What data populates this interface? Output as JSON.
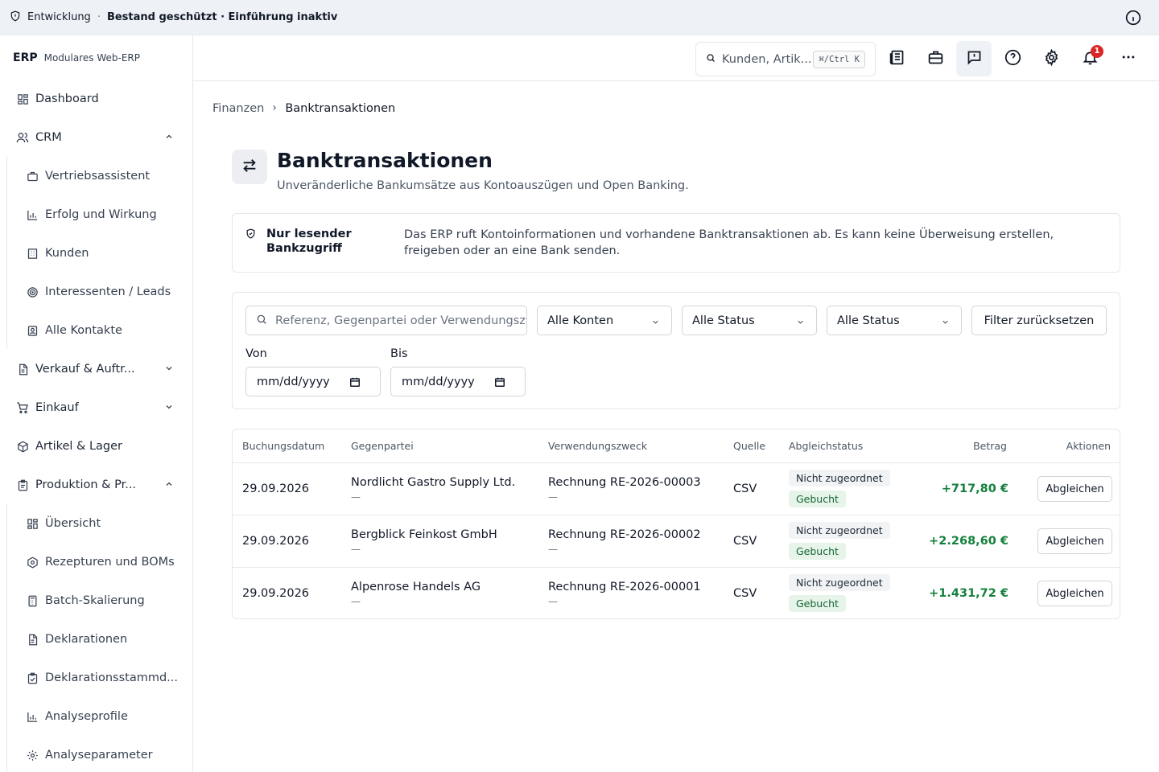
{
  "banner": {
    "env": "Entwicklung",
    "separator": "·",
    "status": "Bestand geschützt · Einführung inaktiv"
  },
  "brand": {
    "logo": "ERP",
    "subtitle": "Modulares Web-ERP"
  },
  "sidebar": {
    "items": [
      {
        "label": "Dashboard",
        "icon": "dashboard-icon"
      },
      {
        "label": "CRM",
        "icon": "users-icon",
        "expanded": true
      },
      {
        "label": "Vertriebsassistent",
        "icon": "briefcase-icon"
      },
      {
        "label": "Erfolg und Wirkung",
        "icon": "bar-chart-icon"
      },
      {
        "label": "Kunden",
        "icon": "building-icon"
      },
      {
        "label": "Interessenten / Leads",
        "icon": "target-icon"
      },
      {
        "label": "Alle Kontakte",
        "icon": "contact-icon"
      },
      {
        "label": "Verkauf & Auftr...",
        "icon": "document-icon",
        "expanded": false
      },
      {
        "label": "Einkauf",
        "icon": "cart-icon",
        "expanded": false
      },
      {
        "label": "Artikel & Lager",
        "icon": "package-icon"
      },
      {
        "label": "Produktion & Pr...",
        "icon": "clipboard-icon",
        "expanded": true
      },
      {
        "label": "Übersicht",
        "icon": "grid-icon"
      },
      {
        "label": "Rezepturen und BOMs",
        "icon": "recipe-icon"
      },
      {
        "label": "Batch-Skalierung",
        "icon": "calculator-icon"
      },
      {
        "label": "Deklarationen",
        "icon": "document-icon"
      },
      {
        "label": "Deklarationsstammd...",
        "icon": "clipboard-check-icon"
      },
      {
        "label": "Analyseprofile",
        "icon": "bar-chart-icon"
      },
      {
        "label": "Analyseparameter",
        "icon": "gear-icon"
      }
    ]
  },
  "header": {
    "search_placeholder": "Kunden, Artik...",
    "shortcut": "⌘/Ctrl K",
    "notification_count": "1"
  },
  "breadcrumb": {
    "parent": "Finanzen",
    "current": "Banktransaktionen"
  },
  "page": {
    "title": "Banktransaktionen",
    "subtitle": "Unveränderliche Bankumsätze aus Kontoauszügen und Open Banking."
  },
  "notice": {
    "title": "Nur lesender Bankzugriff",
    "text": "Das ERP ruft Kontoinformationen und vorhandene Banktransaktionen ab. Es kann keine Überweisung erstellen, freigeben oder an eine Bank senden."
  },
  "filters": {
    "search_placeholder": "Referenz, Gegenpartei oder Verwendungszweck",
    "account": "Alle Konten",
    "status1": "Alle Status",
    "status2": "Alle Status",
    "reset": "Filter zurücksetzen",
    "from_label": "Von",
    "to_label": "Bis",
    "from_value": "mm/dd/yyyy",
    "to_value": "mm/dd/yyyy"
  },
  "table": {
    "columns": [
      "Buchungsdatum",
      "Gegenpartei",
      "Verwendungszweck",
      "Quelle",
      "Abgleichstatus",
      "Betrag",
      "Aktionen"
    ],
    "rows": [
      {
        "date": "29.09.2026",
        "party": "Nordlicht Gastro Supply Ltd.",
        "party_sub": "—",
        "purpose": "Rechnung RE-2026-00003",
        "purpose_sub": "—",
        "source": "CSV",
        "status": "Nicht zugeordnet",
        "booking": "Gebucht",
        "amount": "+717,80 €",
        "action": "Abgleichen"
      },
      {
        "date": "29.09.2026",
        "party": "Bergblick Feinkost GmbH",
        "party_sub": "—",
        "purpose": "Rechnung RE-2026-00002",
        "purpose_sub": "—",
        "source": "CSV",
        "status": "Nicht zugeordnet",
        "booking": "Gebucht",
        "amount": "+2.268,60 €",
        "action": "Abgleichen"
      },
      {
        "date": "29.09.2026",
        "party": "Alpenrose Handels AG",
        "party_sub": "—",
        "purpose": "Rechnung RE-2026-00001",
        "purpose_sub": "—",
        "source": "CSV",
        "status": "Nicht zugeordnet",
        "booking": "Gebucht",
        "amount": "+1.431,72 €",
        "action": "Abgleichen"
      }
    ]
  },
  "colors": {
    "amount_positive": "#15803d",
    "badge": "#dc2626"
  }
}
